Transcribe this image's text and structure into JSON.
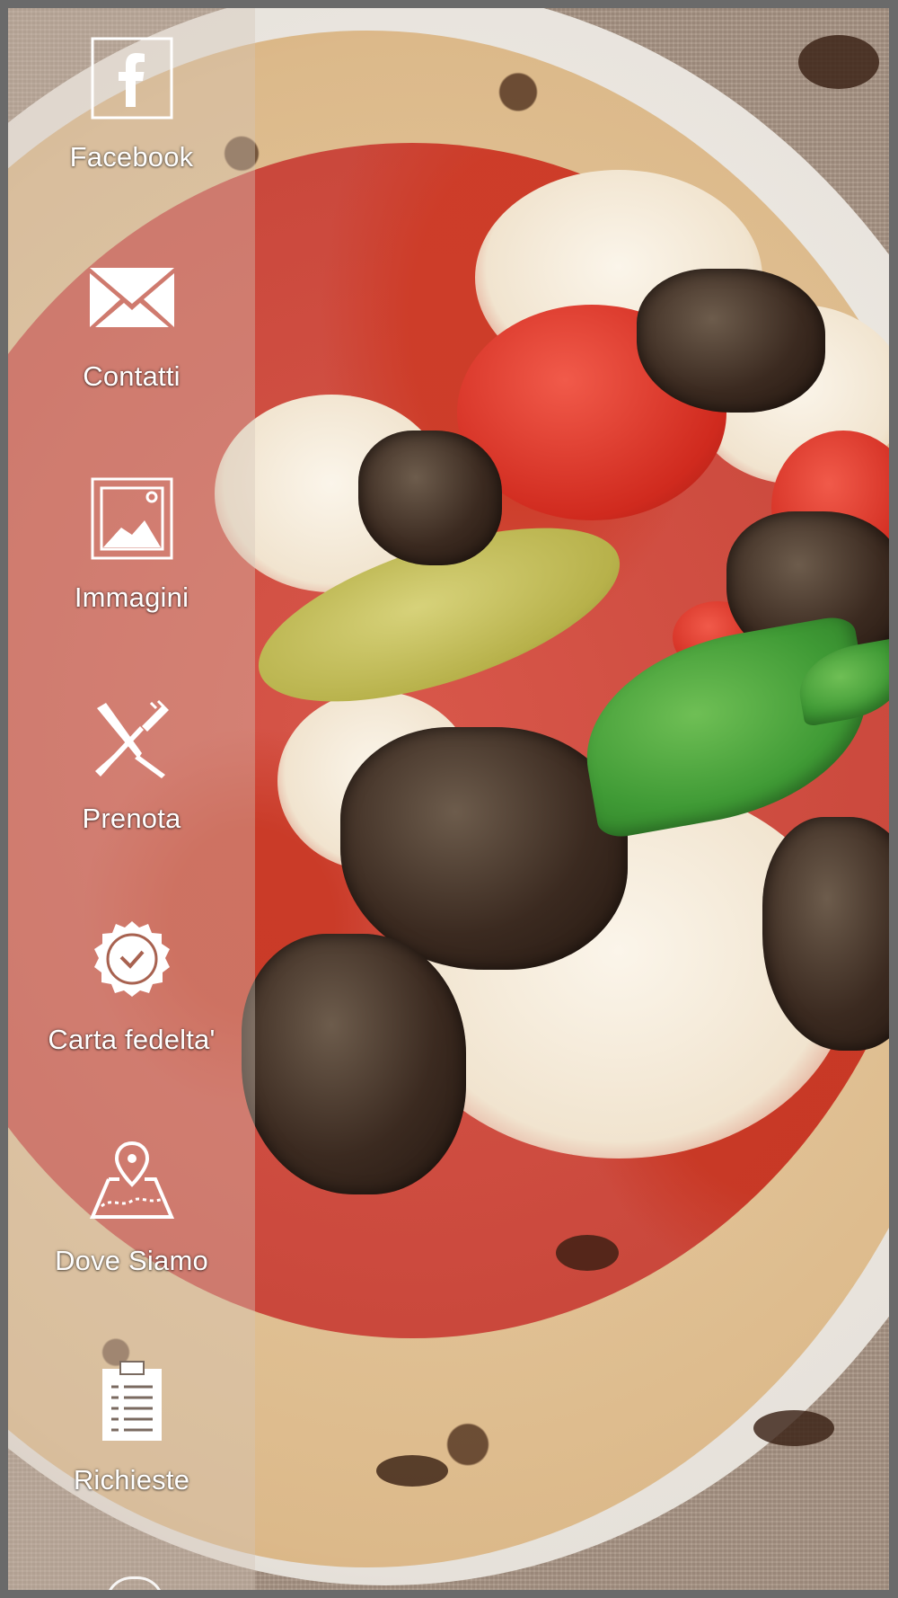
{
  "menu": {
    "items": [
      {
        "label": "Facebook",
        "icon": "facebook-icon"
      },
      {
        "label": "Contatti",
        "icon": "envelope-icon"
      },
      {
        "label": "Immagini",
        "icon": "image-icon"
      },
      {
        "label": "Prenota",
        "icon": "cutlery-icon"
      },
      {
        "label": "Carta fedelta'",
        "icon": "loyalty-badge-icon"
      },
      {
        "label": "Dove Siamo",
        "icon": "map-pin-icon"
      },
      {
        "label": "Richieste",
        "icon": "clipboard-icon"
      }
    ]
  },
  "background": {
    "subject": "pizza-photo",
    "colors": {
      "sidebar_overlay": "#d4c6ba",
      "icon": "#ffffff",
      "frame": "#6a6a6a"
    }
  }
}
